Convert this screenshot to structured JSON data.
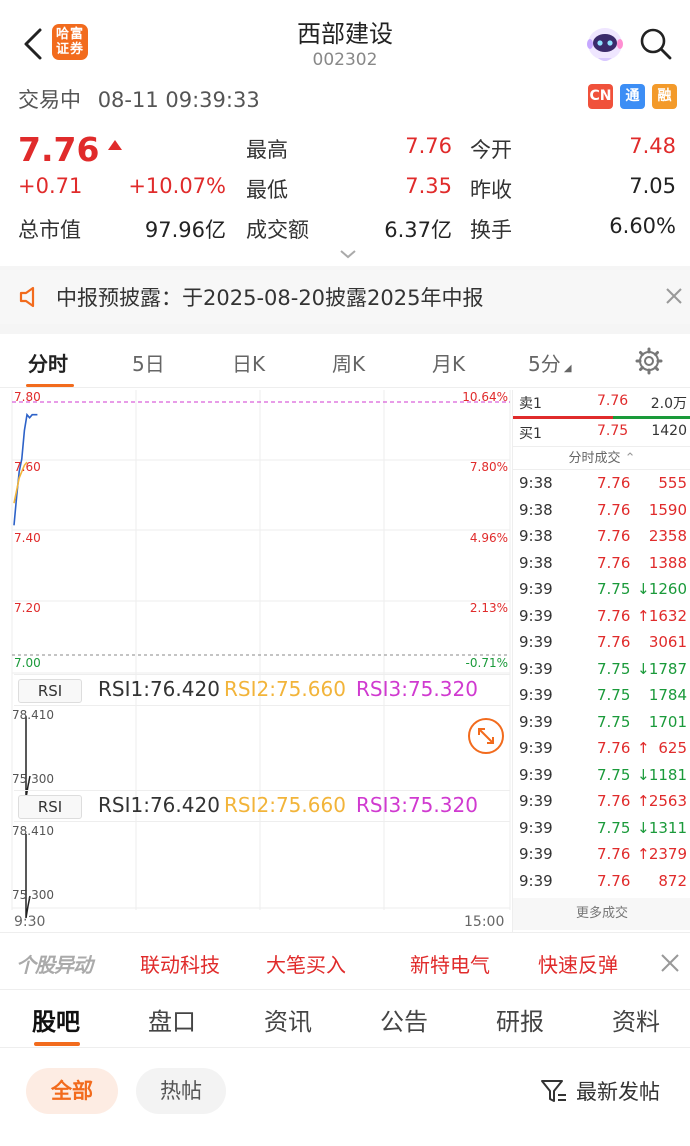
{
  "header": {
    "badge_line1": "哈富",
    "badge_line2": "证券",
    "title": "西部建设",
    "code": "002302"
  },
  "status": {
    "state": "交易中",
    "datetime": "08-11 09:39:33",
    "tags": [
      {
        "label": "CN",
        "color": "#f0513b"
      },
      {
        "label": "通",
        "color": "#3c8ef5"
      },
      {
        "label": "融",
        "color": "#f39a2a"
      }
    ]
  },
  "quote": {
    "price": "7.76",
    "change": "+0.71",
    "change_pct": "+10.07%",
    "high_label": "最高",
    "high": "7.76",
    "open_label": "今开",
    "open": "7.48",
    "low_label": "最低",
    "low": "7.35",
    "prev_close_label": "昨收",
    "prev_close": "7.05",
    "mcap_label": "总市值",
    "mcap": "97.96亿",
    "amount_label": "成交额",
    "amount": "6.37亿",
    "turnover_label": "换手",
    "turnover": "6.60%"
  },
  "notice": {
    "text": "中报预披露：于2025-08-20披露2025年中报"
  },
  "chart_tabs": [
    "分时",
    "5日",
    "日K",
    "周K",
    "月K",
    "5分"
  ],
  "chart_data": {
    "type": "line",
    "title": "",
    "x_start": "9:30",
    "x_end": "15:00",
    "y_ticks_left": [
      "7.80",
      "7.60",
      "7.40",
      "7.20",
      "7.00"
    ],
    "y_ticks_right": [
      "10.64%",
      "7.80%",
      "4.96%",
      "2.13%",
      "-0.71%"
    ],
    "ylim": [
      7.0,
      7.8
    ],
    "series": [
      {
        "color": "#2d62c8",
        "values": [
          7.41,
          7.5,
          7.58,
          7.62,
          7.71,
          7.76,
          7.75,
          7.76,
          7.76,
          7.76
        ]
      },
      {
        "color": "#f2b43a",
        "values": [
          7.48,
          7.52,
          7.56,
          7.58,
          7.6,
          7.61
        ]
      }
    ],
    "limit_up_pct": "10.64%"
  },
  "rsi_panels": [
    {
      "tag": "RSI",
      "rsi1": "RSI1:76.420",
      "rsi2": "RSI2:75.660",
      "rsi3": "RSI3:75.320",
      "axis_top": "78.410",
      "axis_bottom": "75.300"
    },
    {
      "tag": "RSI",
      "rsi1": "RSI1:76.420",
      "rsi2": "RSI2:75.660",
      "rsi3": "RSI3:75.320",
      "axis_top": "78.410",
      "axis_bottom": "75.300"
    }
  ],
  "orderbook": {
    "ask": {
      "label": "卖1",
      "price": "7.76",
      "vol": "2.0万"
    },
    "bid": {
      "label": "买1",
      "price": "7.75",
      "vol": "1420"
    },
    "ticks_header": "分时成交",
    "more": "更多成交",
    "ticks": [
      {
        "time": "9:38",
        "price": "7.76",
        "dir": "",
        "vol": "555",
        "color": "red"
      },
      {
        "time": "9:38",
        "price": "7.76",
        "dir": "",
        "vol": "1590",
        "color": "red"
      },
      {
        "time": "9:38",
        "price": "7.76",
        "dir": "",
        "vol": "2358",
        "color": "red"
      },
      {
        "time": "9:38",
        "price": "7.76",
        "dir": "",
        "vol": "1388",
        "color": "red"
      },
      {
        "time": "9:39",
        "price": "7.75",
        "dir": "↓",
        "vol": "1260",
        "color": "green"
      },
      {
        "time": "9:39",
        "price": "7.76",
        "dir": "↑",
        "vol": "1632",
        "color": "red"
      },
      {
        "time": "9:39",
        "price": "7.76",
        "dir": "",
        "vol": "3061",
        "color": "red"
      },
      {
        "time": "9:39",
        "price": "7.75",
        "dir": "↓",
        "vol": "1787",
        "color": "green"
      },
      {
        "time": "9:39",
        "price": "7.75",
        "dir": "",
        "vol": "1784",
        "color": "green"
      },
      {
        "time": "9:39",
        "price": "7.75",
        "dir": "",
        "vol": "1701",
        "color": "green"
      },
      {
        "time": "9:39",
        "price": "7.76",
        "dir": "↑",
        "vol": "625",
        "color": "red"
      },
      {
        "time": "9:39",
        "price": "7.75",
        "dir": "↓",
        "vol": "1181",
        "color": "green"
      },
      {
        "time": "9:39",
        "price": "7.76",
        "dir": "↑",
        "vol": "2563",
        "color": "red"
      },
      {
        "time": "9:39",
        "price": "7.75",
        "dir": "↓",
        "vol": "1311",
        "color": "green"
      },
      {
        "time": "9:39",
        "price": "7.76",
        "dir": "↑",
        "vol": "2379",
        "color": "red"
      },
      {
        "time": "9:39",
        "price": "7.76",
        "dir": "",
        "vol": "872",
        "color": "red"
      }
    ]
  },
  "movements": {
    "title": "个股异动",
    "items": [
      "联动科技",
      "大笔买入",
      "新特电气",
      "快速反弹"
    ]
  },
  "bottom_tabs": [
    "股吧",
    "盘口",
    "资讯",
    "公告",
    "研报",
    "资料"
  ],
  "filters": {
    "all": "全部",
    "hot": "热帖",
    "sort": "最新发帖"
  }
}
